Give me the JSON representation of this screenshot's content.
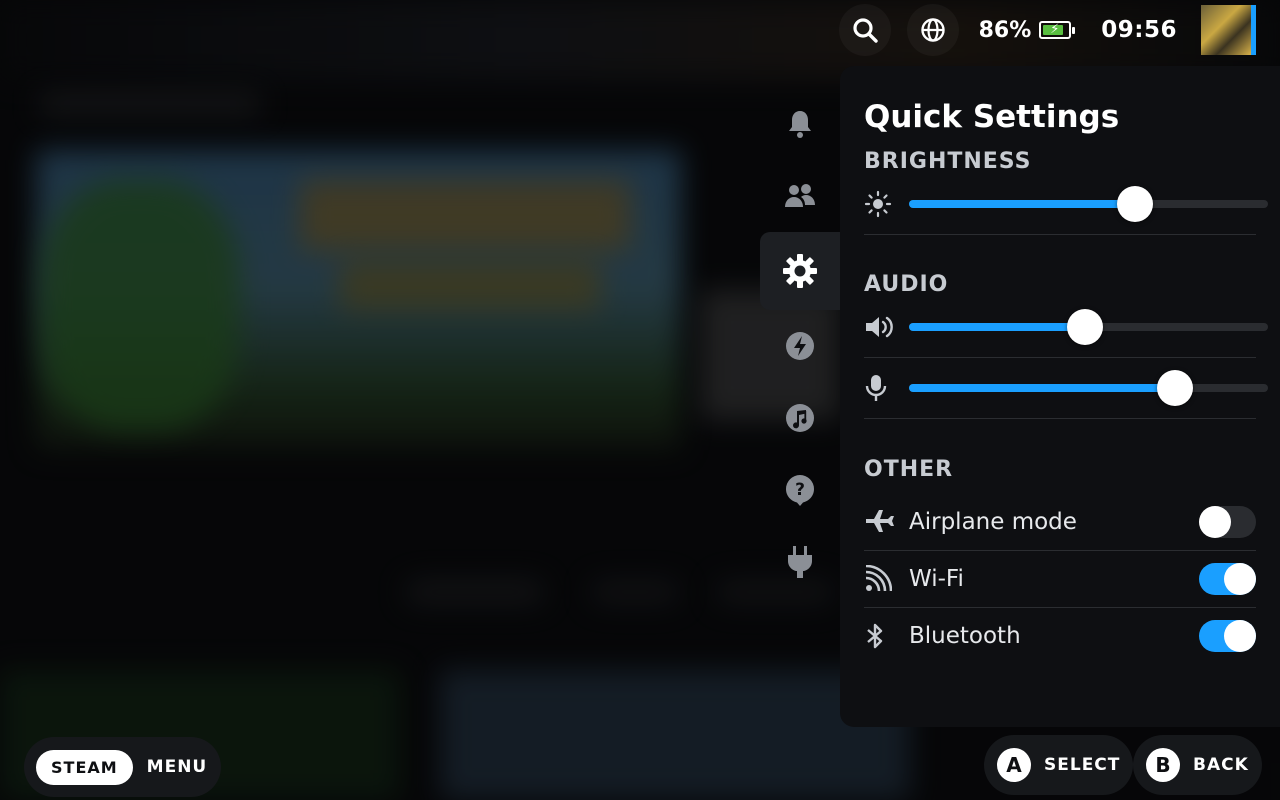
{
  "status": {
    "battery_percent": "86%",
    "battery_level": 0.86,
    "time": "09:56"
  },
  "panel": {
    "title": "Quick Settings",
    "brightness": {
      "header": "BRIGHTNESS",
      "value": 0.63
    },
    "audio": {
      "header": "AUDIO",
      "volume": 0.49,
      "mic": 0.74
    },
    "other": {
      "header": "OTHER",
      "items": [
        {
          "label": "Airplane mode",
          "on": false
        },
        {
          "label": "Wi-Fi",
          "on": true
        },
        {
          "label": "Bluetooth",
          "on": true
        }
      ]
    }
  },
  "nav": {
    "items": [
      "notifications-icon",
      "friends-icon",
      "settings-icon",
      "performance-icon",
      "music-icon",
      "help-icon",
      "power-icon"
    ],
    "active": "settings-icon"
  },
  "footer": {
    "steam": "STEAM",
    "menu": "MENU",
    "select_key": "A",
    "select": "SELECT",
    "back_key": "B",
    "back": "BACK"
  },
  "colors": {
    "accent": "#1a9fff",
    "battery": "#59bf40",
    "panel": "#0e0f12"
  }
}
